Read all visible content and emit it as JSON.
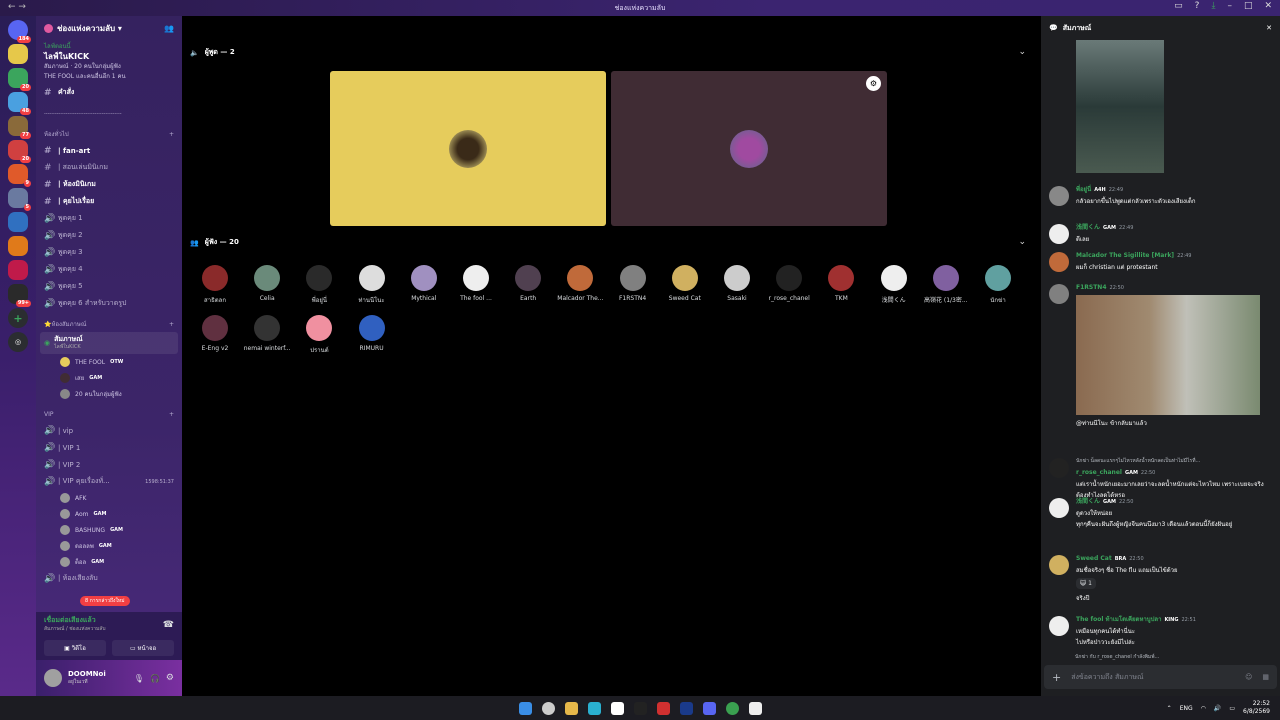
{
  "window": {
    "title": "ช่องแห่งความลับ"
  },
  "servers": [
    {
      "color": "#5865f2",
      "badge": "184"
    },
    {
      "color": "#e6c84a",
      "badge": ""
    },
    {
      "color": "#3ba55d",
      "badge": "20"
    },
    {
      "color": "#4aa0e0",
      "badge": "48"
    },
    {
      "color": "#8a6a3a",
      "badge": "77"
    },
    {
      "color": "#d04040",
      "badge": "20"
    },
    {
      "color": "#e05a2a",
      "badge": "9"
    },
    {
      "color": "#6a7aa0",
      "badge": "5"
    },
    {
      "color": "#3070c0",
      "badge": ""
    },
    {
      "color": "#e07a1a",
      "badge": ""
    },
    {
      "color": "#c01a4a",
      "badge": ""
    },
    {
      "color": "#2a2a2a",
      "badge": "99+"
    }
  ],
  "server_header": "ช่องแห่งความลับ",
  "event": {
    "label": "ไลฟ์ตอนนี้",
    "title": "ไลฟ์ในKICK",
    "line1": "สัมภาษณ์ · 20 คนในกลุ่มผู้ฟัง",
    "line2": "THE FOOL และคนอื่นอีก 1 คน"
  },
  "ch_rules": "คำสั่ง",
  "divider": "-------------------------------------------",
  "cat_general": "ห้องทั่วไป",
  "text_channels": [
    "| fan-art",
    "| สอนเล่นมินิเกม",
    "| ห้องมินิเกม",
    "| คุยไปเรื่อย"
  ],
  "voice_channels": [
    "พูดคุย 1",
    "พูดคุย 2",
    "พูดคุย 3",
    "พูดคุย 4",
    "พูดคุย 5",
    "พูดคุย 6 สำหรับวาดรูป"
  ],
  "cat_stage": "⭐ห้องสัมภาษณ์",
  "stage_ch": {
    "name": "สัมภาษณ์",
    "sub": "ไลฟ์ในKICK"
  },
  "stage_users": [
    {
      "name": "THE FOOL",
      "tag": "OTW"
    },
    {
      "name": "เสย",
      "tag": "GAM"
    },
    {
      "name": "20 คนในกลุ่มผู้ฟัง",
      "tag": ""
    }
  ],
  "cat_vip": "VIP",
  "vip_channels": [
    "| vip",
    "| VIP 1",
    "| VIP 2"
  ],
  "vip_active": {
    "name": "| VIP คุยเรื่องทั่...",
    "timer": "1598:51:37"
  },
  "vip_users": [
    {
      "name": "AFK",
      "tag": ""
    },
    {
      "name": "Aom",
      "tag": "GAM"
    },
    {
      "name": "BASHUNG",
      "tag": "GAM"
    },
    {
      "name": "ดอลลพ",
      "tag": "GAM"
    },
    {
      "name": "ต็อล",
      "tag": "GAM"
    }
  ],
  "vip_more": "| ห้องเสียงลับ",
  "new_unread": "8 การกล่าวถึงใหม่",
  "voice_status": {
    "title": "เชื่อมต่อเสียงแล้ว",
    "sub": "สัมภาษณ์ / ช่องแห่งความลับ",
    "video": "วิดีโอ",
    "screen": "หน้าจอ"
  },
  "user": {
    "name": "DOOMNoi",
    "status": "อยู่ในเวที"
  },
  "speakers_label": "ผู้พูด — 2",
  "audience_label": "ผู้ฟัง — 20",
  "audience": [
    "สาธิตลก",
    "Celia",
    "พี่อยู่นี่",
    "ท่านนีโนะ",
    "Mythical",
    "The fool ...",
    "Earth",
    "Malcador The...",
    "F1RSTN4",
    "Sweed Cat",
    "Sasaki",
    "r_rose_chanel",
    "TKM",
    "浅間くん",
    "高嶺花 (1/3密...",
    "นักฆ่า",
    "E-Eng v2",
    "nemai winterf...",
    "ปรานต์",
    "RIMURU"
  ],
  "audience_colors": [
    "#8a2a2a",
    "#6a8a7a",
    "#2a2a2a",
    "#ddd",
    "#a090c0",
    "#eee",
    "#504050",
    "#c06a3a",
    "#808080",
    "#d0b060",
    "#ccc",
    "#222",
    "#a03030",
    "#eee",
    "#8060a0",
    "#60a0a0",
    "#603040",
    "#333",
    "#f090a0",
    "#3060c0"
  ],
  "chat": {
    "title": "สัมภาษณ์",
    "input_placeholder": "ส่งข้อความถึง สัมภาษณ์"
  },
  "messages": [
    {
      "author": "พี่อยู่นี่",
      "tag": "A4H",
      "time": "22:49",
      "text": "กลัวอยากขึ้นไปพูดแต่กลัวเพราะตัวเองเสียงเด็ก",
      "color": "#3ba55d"
    },
    {
      "author": "浅間くん",
      "tag": "GAM",
      "time": "22:49",
      "text": "ดีเลย",
      "color": "#3ba55d"
    },
    {
      "author": "Malcador The Sigillite [Mark]",
      "tag": "",
      "time": "22:49",
      "text": "ผมก็ christian แต่ protestant",
      "color": "#3ba55d"
    },
    {
      "author": "F1RSTN4",
      "tag": "",
      "time": "22:50",
      "text": "",
      "color": "#3ba55d"
    },
    {
      "author": "",
      "tag": "",
      "time": "",
      "text": "@ท่านนีโนะ ข้ากลับมาแล้ว",
      "color": "#fff"
    },
    {
      "author": "r_rose_chanel",
      "tag": "GAM",
      "time": "22:50",
      "text": "แต่เราน้ำหนักเยอะมากเลยว่าจะลดน้ำหนักแต่จะไหวไหม เพราะเบยจะจริงต้องทำไงลดได้หรอ",
      "color": "#3ba55d",
      "reply": "นักฆ่า น็ลดนะแรกๆไม่ไหวหลังน้ำหนักลดเป็นท่าไม่มีไรที่..."
    },
    {
      "author": "浅間くん",
      "tag": "GAM",
      "time": "22:50",
      "text": "ดูดวงให้หน่อย\nทุกๆคืนจะฝันถึงผู้หญิงจีนคนนึงมา3 เดือนแล้วตอนนี้ก็ยังฝันอยู่",
      "color": "#3ba55d"
    },
    {
      "author": "Sweed Cat",
      "tag": "BRA",
      "time": "22:50",
      "text": "สมชื่อจริงๆ ชื่อ The flu แถมเป็นไข้ด้วย",
      "color": "#3ba55d",
      "reaction": "1"
    },
    {
      "author": "",
      "tag": "",
      "time": "",
      "text": "จริงปี",
      "color": "#fff"
    },
    {
      "author": "The fool ท้าเมโดเคียตหาบูปลา",
      "tag": "KING",
      "time": "22:51",
      "text": "เหมือนทุกคนได้ทำนี่นะ\nไปหรือป่าววะยังมีไปล่ะ",
      "color": "#3ba55d"
    }
  ],
  "typing": "นักฆ่า กับ r_rose_chanel กำลังพิมพ์...",
  "taskbar": {
    "lang": "ENG",
    "time": "22:52",
    "date": "6/8/2569"
  }
}
